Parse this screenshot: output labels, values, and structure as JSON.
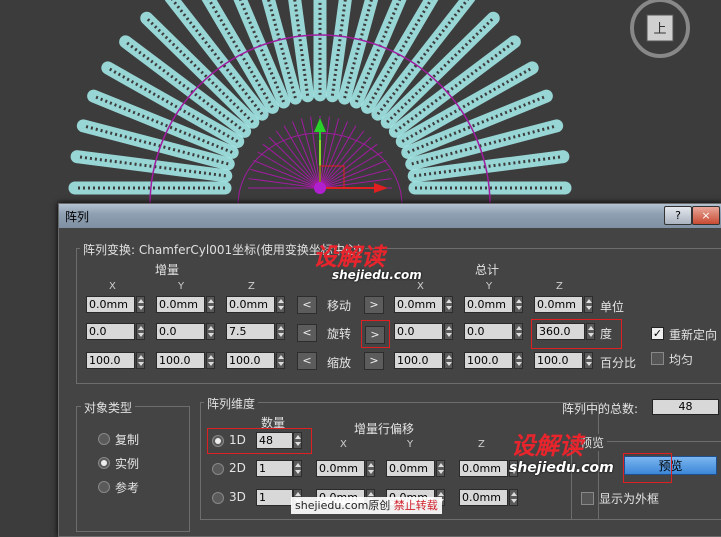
{
  "dialog": {
    "title": "阵列",
    "help_btn": "?",
    "close_btn": "×",
    "transform_group_label": "阵列变换: ChamferCyl001坐标(使用变换坐标中心)",
    "increment_label": "增量",
    "total_label": "总计",
    "axis_x": "X",
    "axis_y": "Y",
    "axis_z": "Z",
    "move_label": "移动",
    "rotate_label": "旋转",
    "scale_label": "缩放",
    "units_label": "单位",
    "degrees_label": "度",
    "percent_label": "百分比",
    "reorient_label": "重新定向",
    "reorient_checked": true,
    "uniform_label": "均匀",
    "uniform_checked": false,
    "left_arrow": "<",
    "right_arrow": ">",
    "move": {
      "inc_x": "0.0mm",
      "inc_y": "0.0mm",
      "inc_z": "0.0mm",
      "tot_x": "0.0mm",
      "tot_y": "0.0mm",
      "tot_z": "0.0mm"
    },
    "rotate": {
      "inc_x": "0.0",
      "inc_y": "0.0",
      "inc_z": "7.5",
      "tot_x": "0.0",
      "tot_y": "0.0",
      "tot_z": "360.0"
    },
    "scale": {
      "inc_x": "100.0",
      "inc_y": "100.0",
      "inc_z": "100.0",
      "tot_x": "100.0",
      "tot_y": "100.0",
      "tot_z": "100.0"
    },
    "object_type_label": "对象类型",
    "copy_label": "复制",
    "instance_label": "实例",
    "reference_label": "参考",
    "dimensions_label": "阵列维度",
    "count_label": "数量",
    "row_offset_label": "增量行偏移",
    "d1_label": "1D",
    "d2_label": "2D",
    "d3_label": "3D",
    "d1_count": "48",
    "d2_count": "1",
    "d3_count": "1",
    "d2_offsets": [
      "0.0mm",
      "0.0mm",
      "0.0mm"
    ],
    "d3_offsets": [
      "0.0mm",
      "0.0mm",
      "0.0mm"
    ],
    "total_count_label": "阵列中的总数:",
    "total_count_value": "48",
    "preview_group_label": "预览",
    "preview_btn": "预览",
    "show_box_label": "显示为外框"
  },
  "watermark": {
    "brand": "设解读",
    "site": "shejiedu.com",
    "footer_site": "shejiedu.com",
    "footer_original": "原创",
    "footer_forbid": "禁止转载"
  },
  "colors": {
    "selection_purple": "#a01ca0",
    "wire_cyan": "#a9f0f0",
    "highlight_red": "#e02020"
  }
}
